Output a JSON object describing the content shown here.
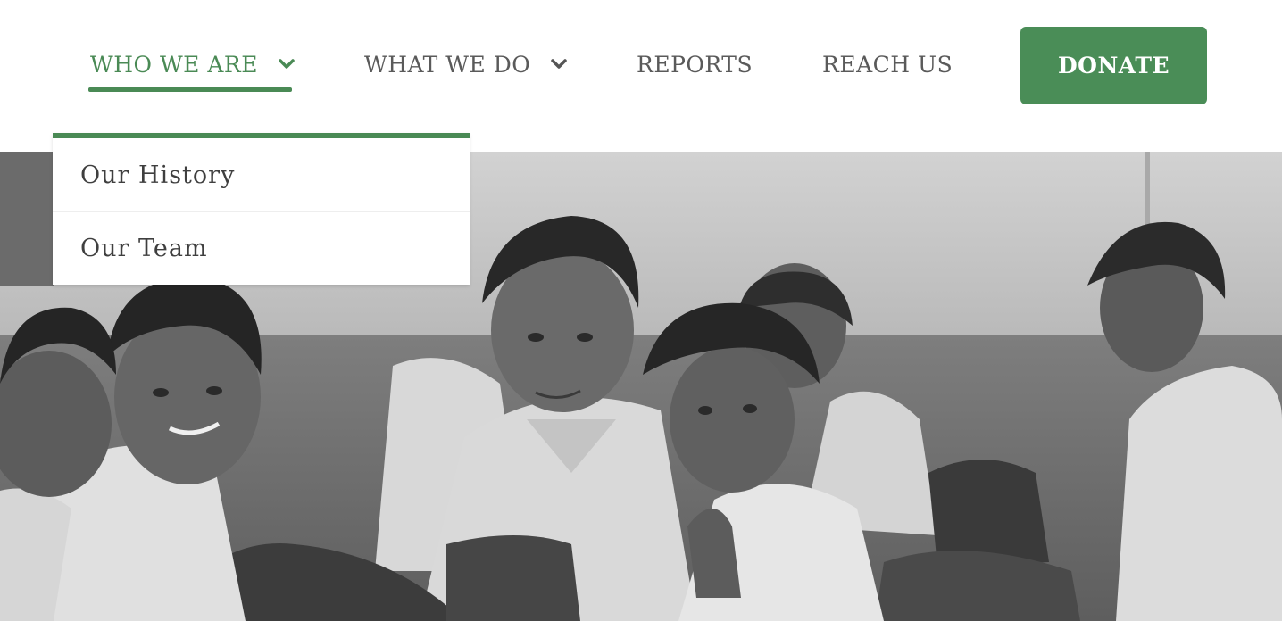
{
  "nav": {
    "items": [
      {
        "label": "WHO WE ARE",
        "has_dropdown": true,
        "active": true
      },
      {
        "label": "WHAT WE DO",
        "has_dropdown": true,
        "active": false
      },
      {
        "label": "REPORTS",
        "has_dropdown": false,
        "active": false
      },
      {
        "label": "REACH US",
        "has_dropdown": false,
        "active": false
      }
    ],
    "donate_label": "DONATE"
  },
  "dropdown": {
    "items": [
      {
        "label": "Our History"
      },
      {
        "label": "Our Team"
      }
    ]
  },
  "hero": {
    "description_icon": "photo-icon"
  },
  "colors": {
    "accent_green": "#4a8a55",
    "nav_text": "#5a5a5a",
    "donate_bg": "#4a8d57",
    "dropdown_text": "#3f3f3f"
  }
}
